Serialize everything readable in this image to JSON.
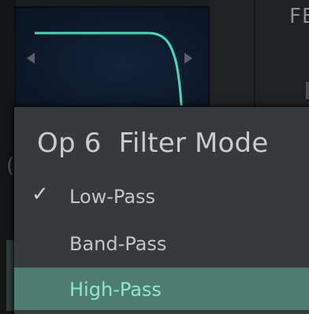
{
  "filter_display": {
    "curve_color": "#3be0b4",
    "nav_prev_icon": "triangle-left-icon",
    "nav_next_icon": "triangle-right-icon"
  },
  "right_panel": {
    "label": "FE"
  },
  "popup": {
    "title": "Op 6  Filter Mode",
    "items": [
      {
        "label": "Low-Pass",
        "checked": true,
        "check_glyph": "✓"
      },
      {
        "label": "Band-Pass",
        "checked": false
      },
      {
        "label": "High-Pass",
        "checked": false,
        "highlighted": true
      }
    ],
    "highlight_color": "#4e7c71",
    "highlight_text_color": "#8fe6d0"
  }
}
